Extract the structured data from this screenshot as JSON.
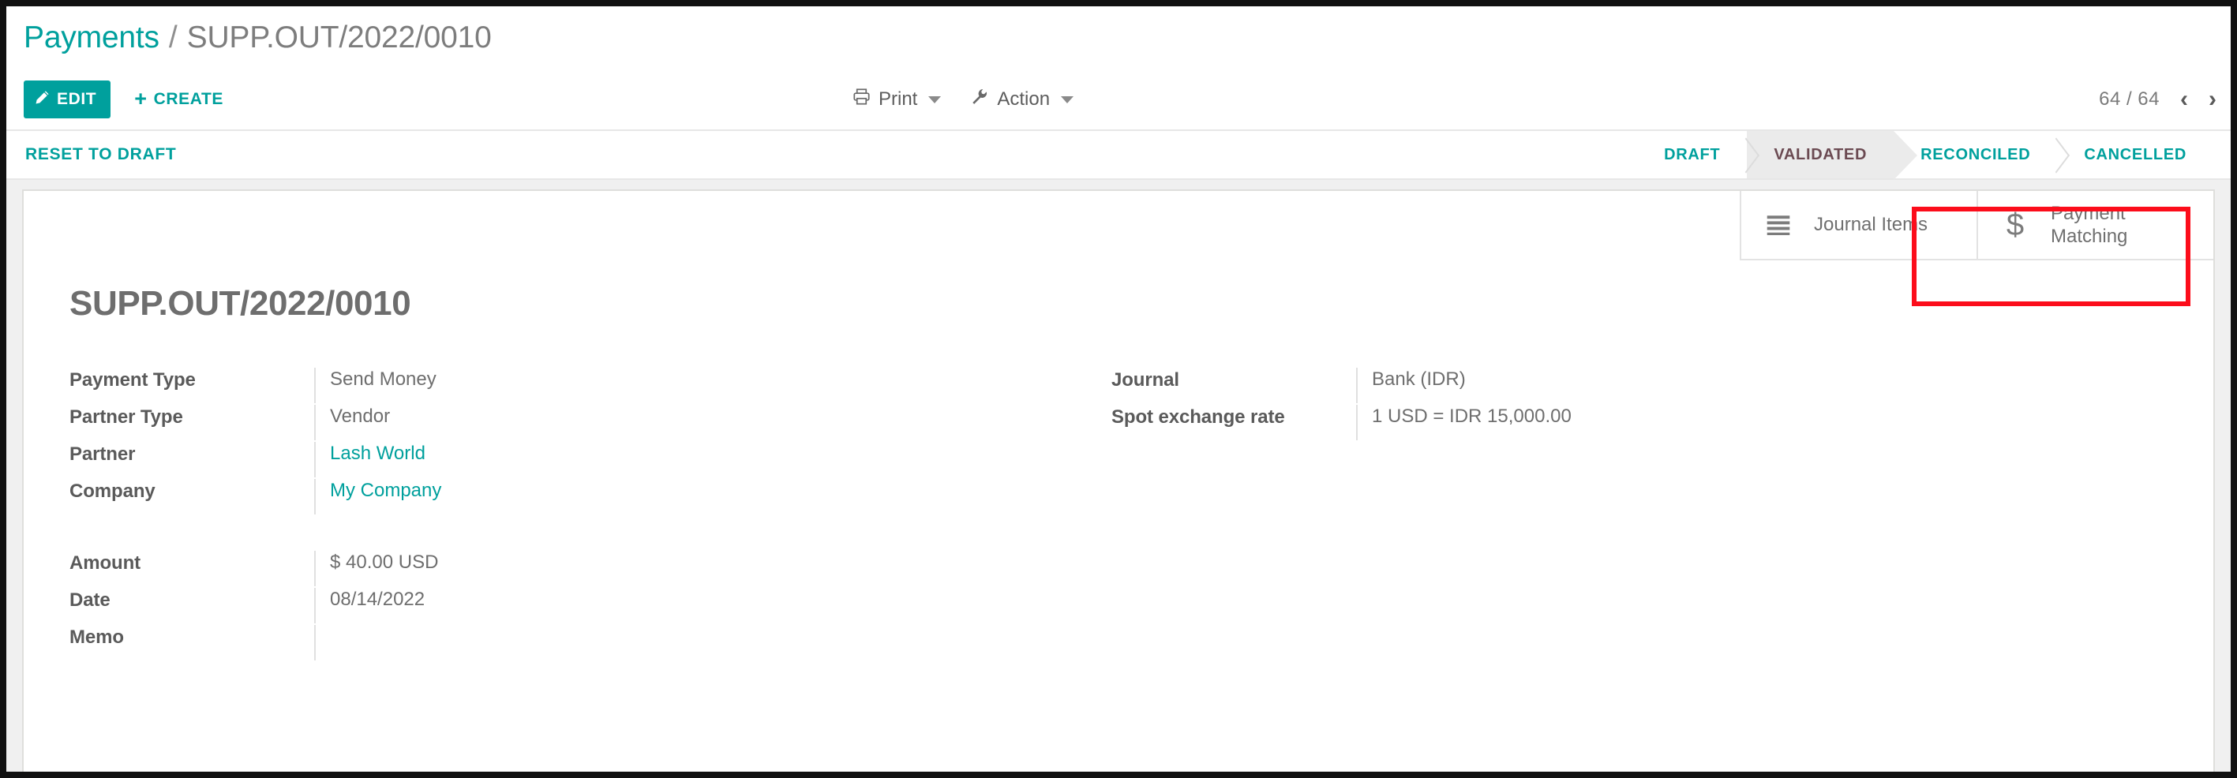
{
  "breadcrumb": {
    "parent": "Payments",
    "separator": "/",
    "current": "SUPP.OUT/2022/0010"
  },
  "control_panel": {
    "edit_label": "EDIT",
    "edit_icon": "pencil-icon",
    "create_label": "CREATE",
    "create_icon": "plus-icon",
    "print_label": "Print",
    "print_icon": "printer-icon",
    "action_label": "Action",
    "action_icon": "wrench-icon",
    "pager_value": "64 / 64",
    "pager_prev_icon": "chevron-left-icon",
    "pager_next_icon": "chevron-right-icon",
    "pager_prev_glyph": "‹",
    "pager_next_glyph": "›"
  },
  "status_bar": {
    "reset_label": "RESET TO DRAFT",
    "steps": [
      {
        "label": "DRAFT",
        "active": false
      },
      {
        "label": "VALIDATED",
        "active": true
      },
      {
        "label": "RECONCILED",
        "active": false
      },
      {
        "label": "CANCELLED",
        "active": false
      }
    ]
  },
  "smart_buttons": [
    {
      "label": "Journal Items",
      "icon": "list-bars-icon",
      "highlighted": false
    },
    {
      "label": "Payment\nMatching",
      "icon": "dollar-icon",
      "glyph": "$",
      "highlighted": true
    }
  ],
  "record": {
    "title": "SUPP.OUT/2022/0010",
    "left_group_1": [
      {
        "label": "Payment Type",
        "value": "Send Money",
        "link": false
      },
      {
        "label": "Partner Type",
        "value": "Vendor",
        "link": false
      },
      {
        "label": "Partner",
        "value": "Lash World",
        "link": true
      },
      {
        "label": "Company",
        "value": "My Company",
        "link": true
      }
    ],
    "left_group_2": [
      {
        "label": "Amount",
        "value": "$ 40.00  USD",
        "link": false
      },
      {
        "label": "Date",
        "value": "08/14/2022",
        "link": false
      },
      {
        "label": "Memo",
        "value": "",
        "link": false
      }
    ],
    "right_group_1": [
      {
        "label": "Journal",
        "value": "Bank (IDR)",
        "link": false
      },
      {
        "label": "Spot exchange rate",
        "value": "1 USD = IDR 15,000.00",
        "link": false
      }
    ]
  },
  "colors": {
    "accent_teal": "#00a09d",
    "highlight_red": "#fc0d1b",
    "active_step_text": "#6b4a52",
    "active_step_bg": "#ebebeb",
    "sheet_bg": "#f0f0f0"
  }
}
